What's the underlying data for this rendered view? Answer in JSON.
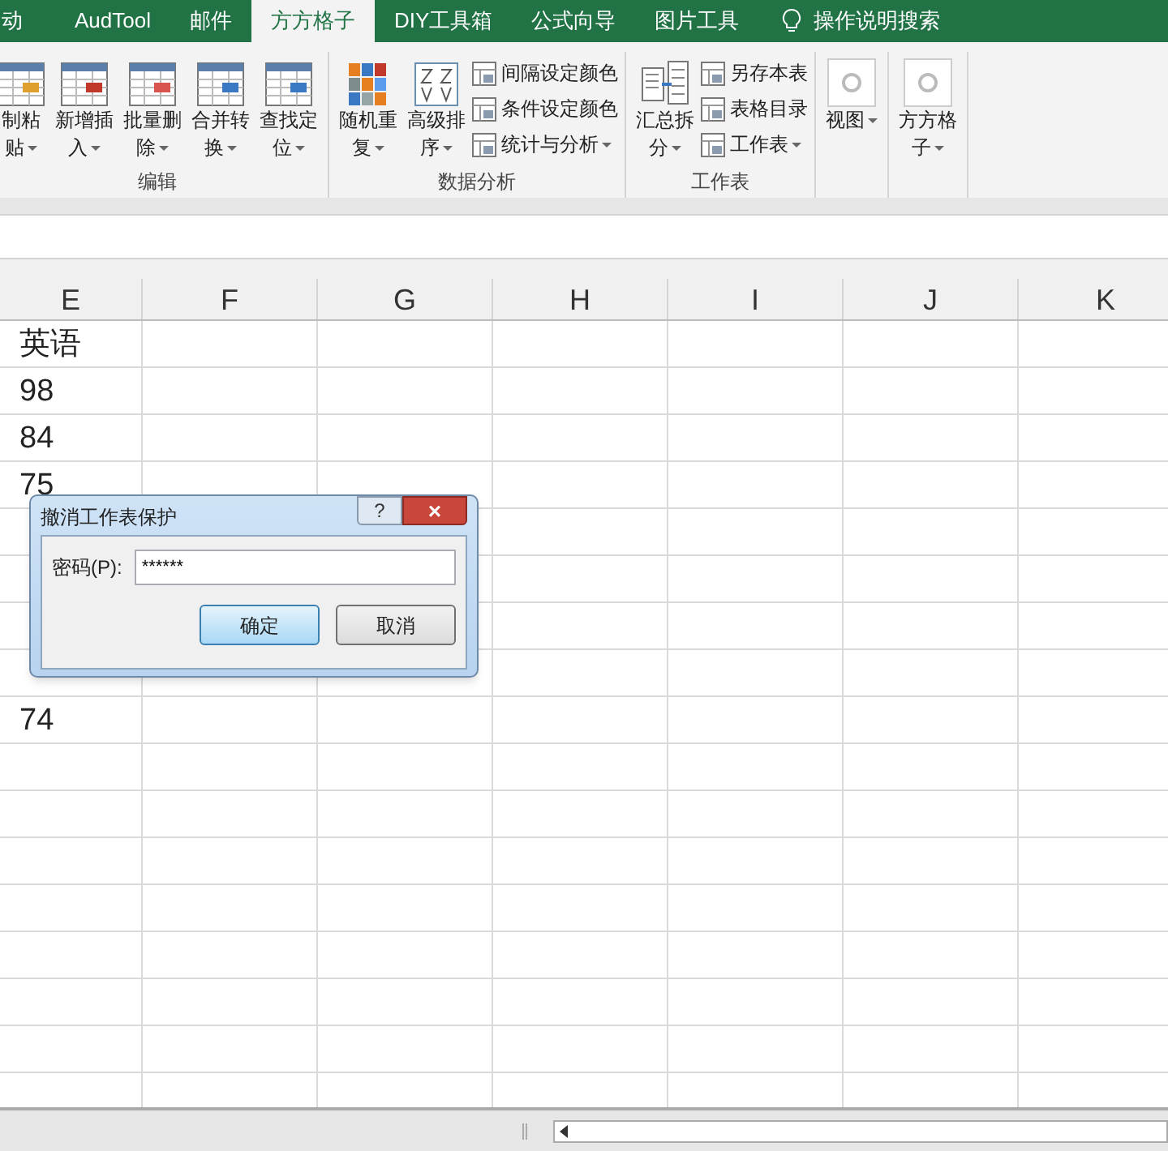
{
  "tabs": [
    {
      "label": "动",
      "selected": false
    },
    {
      "label": "AudTool",
      "selected": false
    },
    {
      "label": "邮件",
      "selected": false
    },
    {
      "label": "方方格子",
      "selected": true
    },
    {
      "label": "DIY工具箱",
      "selected": false
    },
    {
      "label": "公式向导",
      "selected": false
    },
    {
      "label": "图片工具",
      "selected": false
    }
  ],
  "tell_me": "操作说明搜索",
  "groups": [
    {
      "label": "编辑",
      "items": [
        {
          "kind": "large",
          "lines": [
            "制粘",
            "贴"
          ],
          "dropdown": true
        },
        {
          "kind": "large",
          "lines": [
            "新增插",
            "入"
          ],
          "dropdown": true
        },
        {
          "kind": "large",
          "lines": [
            "批量删",
            "除"
          ],
          "dropdown": true
        },
        {
          "kind": "large",
          "lines": [
            "合并转",
            "换"
          ],
          "dropdown": true
        },
        {
          "kind": "large",
          "lines": [
            "查找定",
            "位"
          ],
          "dropdown": true
        }
      ]
    },
    {
      "label": "数据分析",
      "items": [
        {
          "kind": "large",
          "lines": [
            "随机重",
            "复"
          ],
          "dropdown": true
        },
        {
          "kind": "large",
          "lines": [
            "高级排",
            "序"
          ],
          "dropdown": true
        },
        {
          "kind": "small",
          "lines": [
            "间隔设定颜色"
          ],
          "dropdown": false
        },
        {
          "kind": "small",
          "lines": [
            "条件设定颜色"
          ],
          "dropdown": false
        },
        {
          "kind": "small",
          "lines": [
            "统计与分析"
          ],
          "dropdown": true
        }
      ]
    },
    {
      "label": "工作表",
      "items": [
        {
          "kind": "large",
          "lines": [
            "汇总拆",
            "分"
          ],
          "dropdown": true
        },
        {
          "kind": "small",
          "lines": [
            "另存本表"
          ],
          "dropdown": false
        },
        {
          "kind": "small",
          "lines": [
            "表格目录"
          ],
          "dropdown": false
        },
        {
          "kind": "small",
          "lines": [
            "工作表"
          ],
          "dropdown": true
        }
      ]
    },
    {
      "items": [
        {
          "kind": "boxed",
          "lines": [
            "视图"
          ],
          "dropdown": true
        }
      ]
    },
    {
      "items": [
        {
          "kind": "boxed",
          "lines": [
            "方方格",
            "子"
          ],
          "dropdown": true
        }
      ]
    }
  ],
  "columns": [
    "E",
    "F",
    "G",
    "H",
    "I",
    "J",
    "K"
  ],
  "rows": [
    {
      "e": "英语"
    },
    {
      "e": "98"
    },
    {
      "e": "84"
    },
    {
      "e": "75"
    },
    {},
    {},
    {},
    {},
    {
      "e": "74"
    }
  ],
  "dialog": {
    "title": "撤消工作表保护",
    "help": "?",
    "close": "×",
    "field_label": "密码(P):",
    "field_value": "******",
    "buttons": [
      {
        "label": "确定",
        "selected": true
      },
      {
        "label": "取消",
        "selected": false
      }
    ]
  }
}
